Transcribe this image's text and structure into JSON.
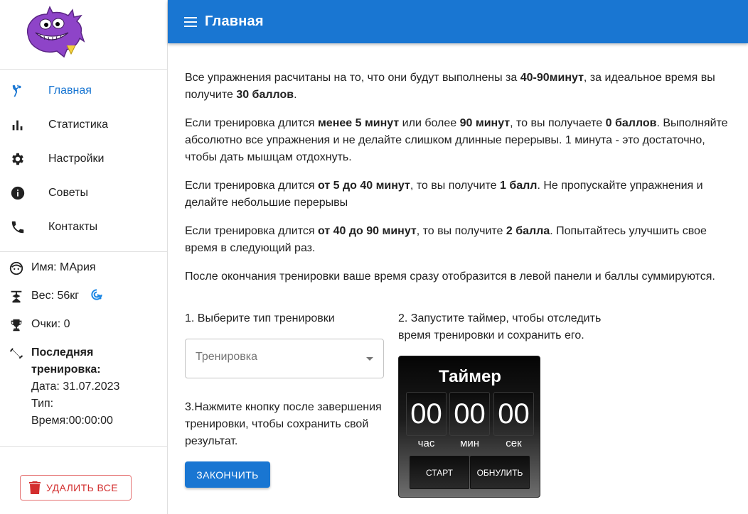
{
  "sidebar": {
    "nav": [
      {
        "label": "Главная",
        "icon": "exercise-icon",
        "active": true
      },
      {
        "label": "Статистика",
        "icon": "bar-chart-icon",
        "active": false
      },
      {
        "label": "Настройки",
        "icon": "gear-icon",
        "active": false
      },
      {
        "label": "Советы",
        "icon": "info-icon",
        "active": false
      },
      {
        "label": "Контакты",
        "icon": "phone-icon",
        "active": false
      }
    ],
    "profile": {
      "name": "Имя: МАрия",
      "weight": "Вес: 56кг",
      "points": "Очки: 0",
      "last_title_1": "Последняя",
      "last_title_2": "тренировка:",
      "date": "Дата: 31.07.2023",
      "type": "Тип:",
      "time": "Время:00:00:00"
    },
    "delete_label": "УДАЛИТЬ ВСЕ"
  },
  "header": {
    "title": "Главная"
  },
  "main": {
    "p1": {
      "a": "Все упражнения расчитаны на то, что они будут выполнены за ",
      "b": "40-90минут",
      "c": ", за идеальное время вы получите ",
      "d": "30 баллов",
      "e": "."
    },
    "p2": {
      "a": "Если тренировка длится ",
      "b": "менее 5 минут",
      "c": " или более ",
      "d": "90 минут",
      "e": ", то вы получаете ",
      "f": "0 баллов",
      "g": ". Выполняйте абсолютно все упражнения и не делайте слишком длинные перерывы. 1 минута - это достаточно, чтобы дать мышцам отдохнуть."
    },
    "p3": {
      "a": "Если тренировка длится ",
      "b": "от 5 до 40 минут",
      "c": ", то вы получите ",
      "d": "1 балл",
      "e": ". Не пропускайте упражнения и делайте небольшие перерывы"
    },
    "p4": {
      "a": "Если тренировка длится ",
      "b": "от 40 до 90 минут",
      "c": ", то вы получите ",
      "d": "2 балла",
      "e": ". Попытайтесь улучшить свое время в следующий раз."
    },
    "p5": "После окончания тренировки ваше время сразу отобразится в левой панели и баллы суммируются.",
    "step1": "1. Выберите тип тренировки",
    "select_placeholder": "Тренировка",
    "step3": "3.Нажмите кнопку после завершения тренировки, чтобы сохранить свой результат.",
    "finish_label": "ЗАКОНЧИТЬ",
    "step2": "2. Запустите таймер, чтобы отследить время тренировки и сохранить его."
  },
  "timer": {
    "title": "Таймер",
    "hours": "00",
    "minutes": "00",
    "seconds": "00",
    "hours_label": "час",
    "minutes_label": "мин",
    "seconds_label": "сек",
    "start_label": "СТАРТ",
    "reset_label": "ОБНУЛИТЬ"
  },
  "colors": {
    "primary": "#1976d2",
    "danger": "#d32f2f",
    "logo": "#8e44c8"
  }
}
